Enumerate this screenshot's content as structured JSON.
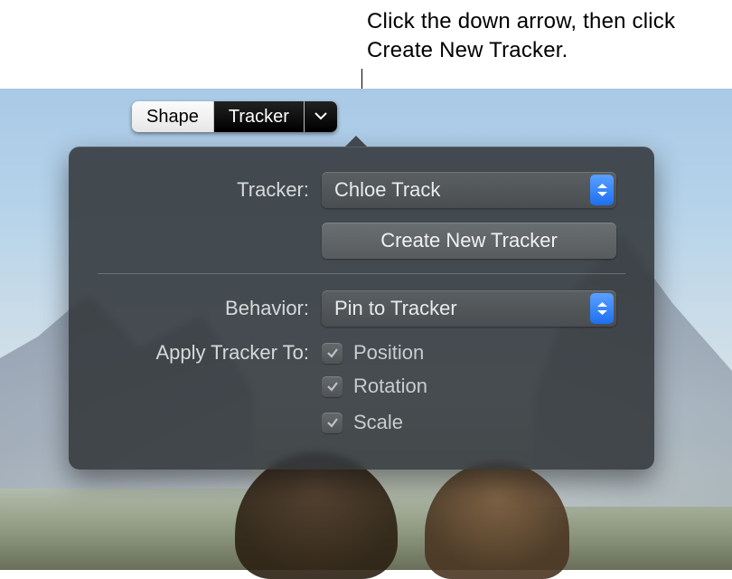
{
  "caption": "Click the down arrow, then click Create New Tracker.",
  "segmented": {
    "shape_label": "Shape",
    "tracker_label": "Tracker"
  },
  "panel": {
    "tracker_label": "Tracker:",
    "tracker_value": "Chloe Track",
    "create_button_label": "Create New Tracker",
    "behavior_label": "Behavior:",
    "behavior_value": "Pin to Tracker",
    "apply_label": "Apply Tracker To:",
    "options": {
      "position": {
        "label": "Position",
        "checked": true
      },
      "rotation": {
        "label": "Rotation",
        "checked": true
      },
      "scale": {
        "label": "Scale",
        "checked": true
      }
    }
  }
}
